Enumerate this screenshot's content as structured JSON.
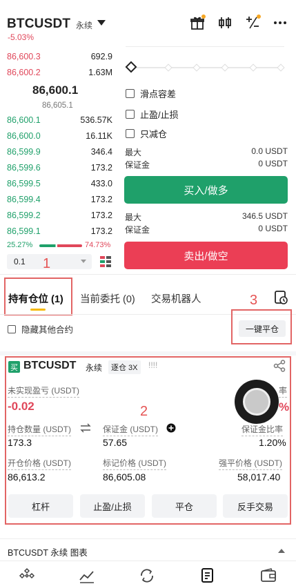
{
  "header": {
    "symbol": "BTCUSDT",
    "contract_type": "永续",
    "change": "-5.03%",
    "icons": [
      "gift-icon",
      "candlestick-icon",
      "calculator-icon",
      "more-icon"
    ]
  },
  "orderbook": {
    "asks": [
      {
        "price": "86,600.3",
        "qty": "692.9",
        "depth": 0.22
      },
      {
        "price": "86,600.2",
        "qty": "1.63M",
        "depth": 1.0
      }
    ],
    "last_price": "86,600.1",
    "mark_price": "86,605.1",
    "bids": [
      {
        "price": "86,600.1",
        "qty": "536.57K",
        "depth": 0.34
      },
      {
        "price": "86,600.0",
        "qty": "16.11K",
        "depth": 0.28
      },
      {
        "price": "86,599.9",
        "qty": "346.4",
        "depth": 0.24
      },
      {
        "price": "86,599.6",
        "qty": "173.2",
        "depth": 0.24
      },
      {
        "price": "86,599.5",
        "qty": "433.0",
        "depth": 0.24
      },
      {
        "price": "86,599.4",
        "qty": "173.2",
        "depth": 0.24
      },
      {
        "price": "86,599.2",
        "qty": "173.2",
        "depth": 0.24
      },
      {
        "price": "86,599.1",
        "qty": "173.2",
        "depth": 0.24
      }
    ],
    "buy_ratio": "25.27%",
    "sell_ratio": "74.73%",
    "precision": "0.1"
  },
  "order_panel": {
    "options": [
      "滑点容差",
      "止盈/止损",
      "只减仓"
    ],
    "buy_max_label": "最大",
    "buy_max_value": "0.0 USDT",
    "buy_margin_label": "保证金",
    "buy_margin_value": "0 USDT",
    "buy_button": "买入/做多",
    "sell_max_label": "最大",
    "sell_max_value": "346.5 USDT",
    "sell_margin_label": "保证金",
    "sell_margin_value": "0 USDT",
    "sell_button": "卖出/做空"
  },
  "tabs": {
    "positions": "持有仓位 (1)",
    "open_orders": "当前委托 (0)",
    "bots": "交易机器人"
  },
  "toolbar": {
    "hide_other": "隐藏其他合约",
    "close_all": "一键平仓"
  },
  "annotations": {
    "n1": "1",
    "n2": "2",
    "n3": "3"
  },
  "position": {
    "badge": "买",
    "symbol": "BTCUSDT",
    "type": "永续",
    "mode": "逐仓 3X",
    "bars": "!!!!",
    "pnl_label": "未实现盈亏 (USDT)",
    "pnl_value": "-0.02",
    "roe_label": "率",
    "roe_value": "%",
    "qty_label": "持仓数量 (USDT)",
    "qty_value": "173.3",
    "margin_label": "保证金 (USDT)",
    "margin_value": "57.65",
    "margin_ratio_label": "保证金比率",
    "margin_ratio_value": "1.20%",
    "entry_label": "开仓价格 (USDT)",
    "entry_value": "86,613.2",
    "mark_label": "标记价格 (USDT)",
    "mark_value": "86,605.08",
    "liq_label": "强平价格 (USDT)",
    "liq_value": "58,017.40",
    "buttons": [
      "杠杆",
      "止盈/止损",
      "平仓",
      "反手交易"
    ]
  },
  "footer": {
    "chart_label": "BTCUSDT 永续  图表"
  },
  "colors": {
    "green": "#1fa06a",
    "red": "#e0475a",
    "accent": "#f5b800",
    "annotation": "#e26464"
  }
}
